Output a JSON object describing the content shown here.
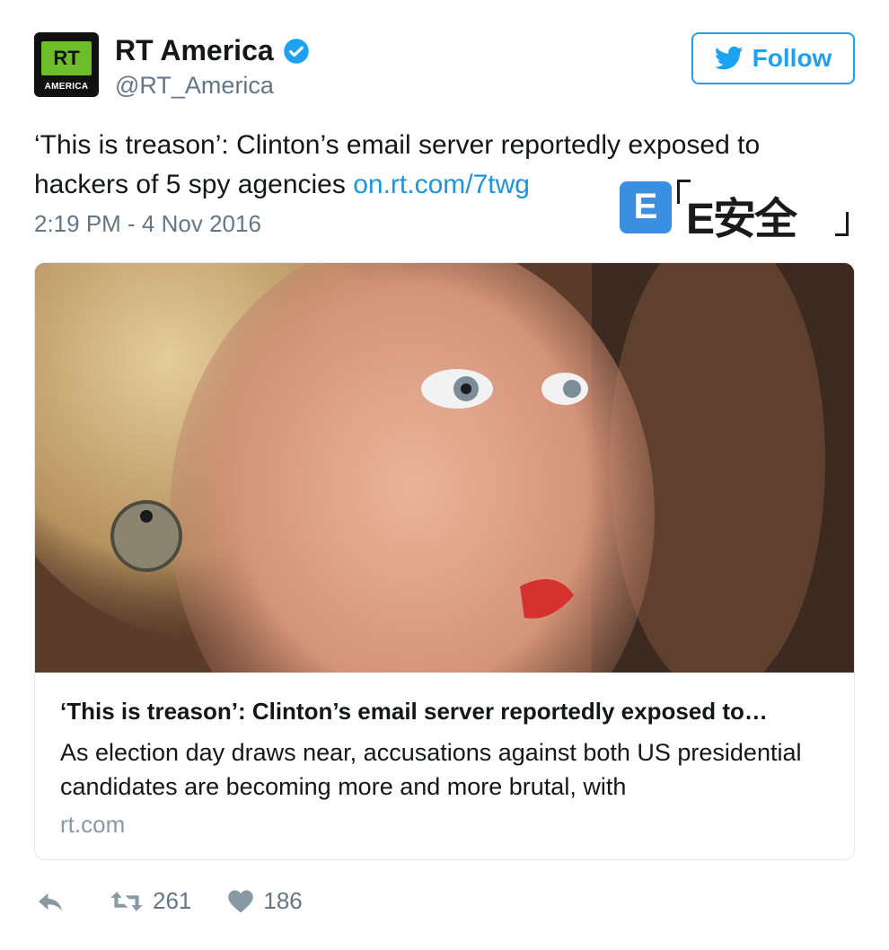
{
  "account": {
    "avatar_logo_text": "RT",
    "avatar_sub_text": "AMERICA",
    "name": "RT America",
    "handle": "@RT_America",
    "verified_icon": "verified-badge-icon"
  },
  "follow": {
    "label": "Follow",
    "icon": "twitter-bird-icon",
    "color": "#1da1f2"
  },
  "tweet": {
    "text": "‘This is treason’: Clinton’s email server reportedly exposed to hackers of 5 spy agencies ",
    "link": "on.rt.com/7twg",
    "timestamp": "2:19 PM - 4 Nov 2016"
  },
  "watermark": {
    "icon_letter": "E",
    "text": "E安全"
  },
  "card": {
    "title": "‘This is treason’: Clinton’s email server reportedly exposed to…",
    "description": "As election day draws near, accusations against both US presidential candidates are becoming more and more brutal, with",
    "domain": "rt.com"
  },
  "actions": {
    "reply_icon": "reply-icon",
    "retweet_icon": "retweet-icon",
    "retweet_count": "261",
    "like_icon": "heart-icon",
    "like_count": "186"
  },
  "colors": {
    "link": "#1b95e0",
    "muted": "#657786",
    "accent": "#1da1f2"
  }
}
